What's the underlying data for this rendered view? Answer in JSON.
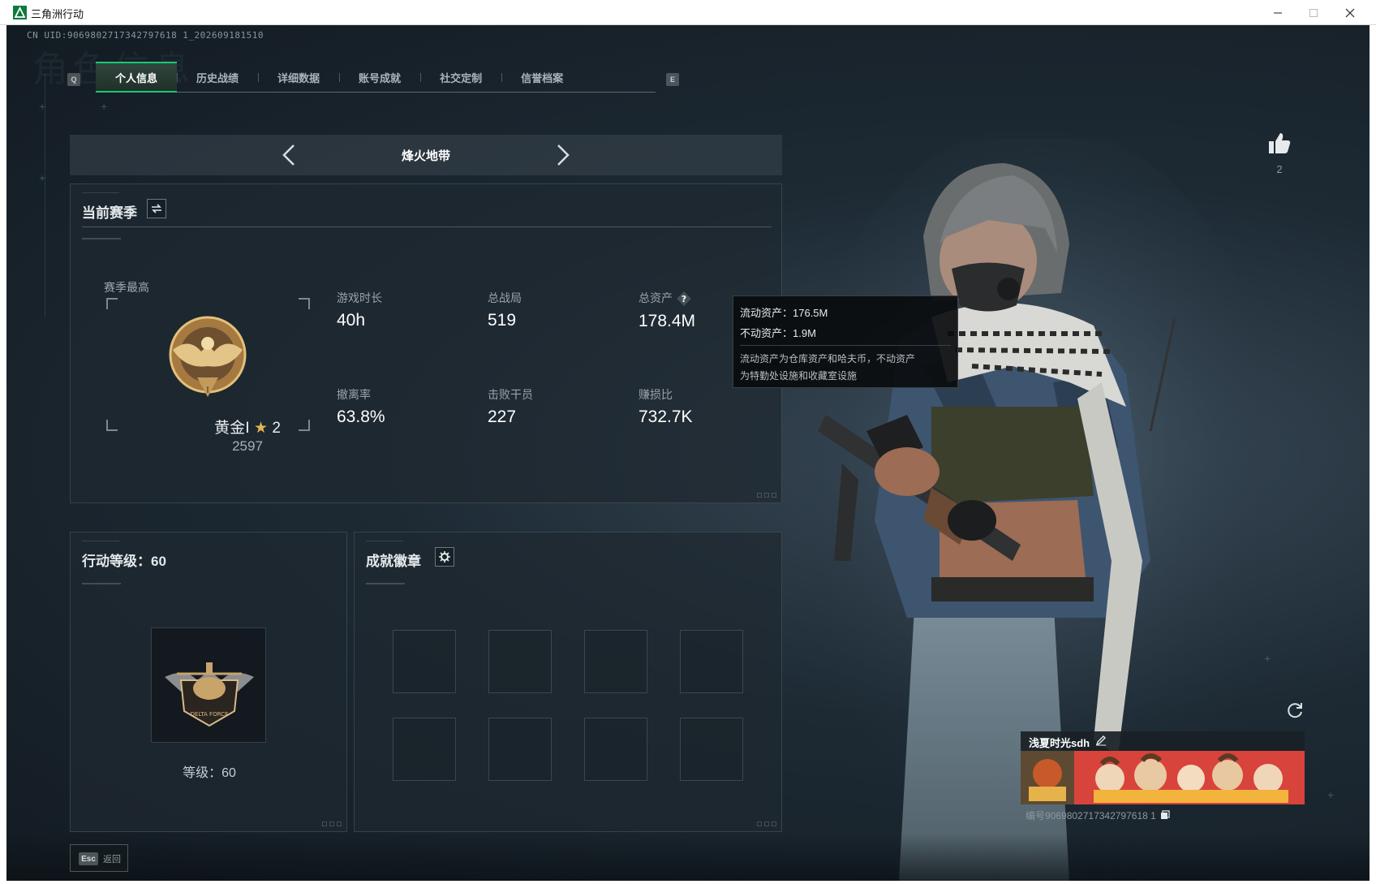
{
  "window": {
    "title": "三角洲行动",
    "controls": [
      "minimize-icon",
      "maximize-icon",
      "close-icon"
    ]
  },
  "uid": "CN UID:9069802717342797618 1_202609181510",
  "watermark": "角色信息",
  "tabs": {
    "left_key": "Q",
    "right_key": "E",
    "items": [
      {
        "label": "个人信息",
        "active": true
      },
      {
        "label": "历史战绩",
        "active": false
      },
      {
        "label": "详细数据",
        "active": false
      },
      {
        "label": "账号成就",
        "active": false
      },
      {
        "label": "社交定制",
        "active": false
      },
      {
        "label": "信誉档案",
        "active": false
      }
    ]
  },
  "mode_selector": {
    "title": "烽火地带",
    "prev_icon": "chevron-left-icon",
    "next_icon": "chevron-right-icon"
  },
  "season": {
    "header": "当前赛季",
    "switch_icon": "swap-icon",
    "best_label": "赛季最高",
    "rank_name": "黄金Ⅰ",
    "rank_stars": "2",
    "rank_score": "2597",
    "stats": [
      {
        "label": "游戏时长",
        "value": "40h"
      },
      {
        "label": "总战局",
        "value": "519"
      },
      {
        "label": "总资产",
        "value": "178.4M",
        "help": true
      },
      {
        "label": "撤离率",
        "value": "63.8%"
      },
      {
        "label": "击败干员",
        "value": "227"
      },
      {
        "label": "赚损比",
        "value": "732.7K"
      }
    ]
  },
  "tooltip": {
    "liquid": "流动资产：176.5M",
    "fixed": "不动资产：1.9M",
    "desc_1": "流动资产为仓库资产和哈夫币，不动资产",
    "desc_2": "为特勤处设施和收藏室设施"
  },
  "action_level": {
    "header": "行动等级：60",
    "level_text": "等级：60",
    "emblem_text": "DELTA FORCE"
  },
  "achievements": {
    "header": "成就徽章",
    "settings_icon": "gear-icon",
    "slot_count": 8
  },
  "likes": {
    "count": "2",
    "icon": "thumbs-up-icon"
  },
  "profile_card": {
    "name": "浅夏时光sdh",
    "edit_icon": "pencil-icon",
    "id_text": "编号9069802717342797618 1",
    "copy_icon": "copy-icon"
  },
  "footer": {
    "esc_key": "Esc",
    "esc_label": "返回"
  },
  "colors": {
    "accent": "#1ac877",
    "background": "#1d2a34",
    "text_primary": "#ffffff",
    "text_secondary": "#98a3a9"
  }
}
